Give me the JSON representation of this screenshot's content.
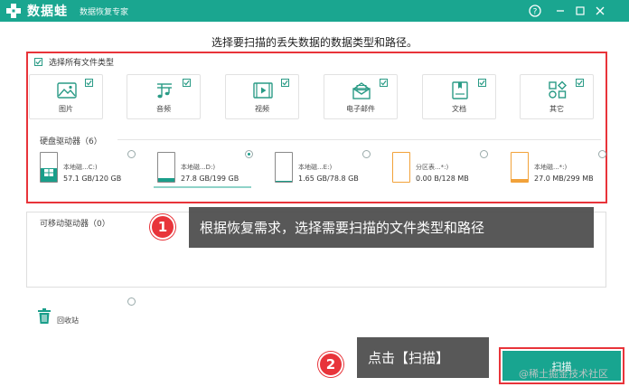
{
  "titlebar": {
    "brand": "数据蛙",
    "subtitle": "数据恢复专家",
    "help_icon": "question-circle-icon",
    "colors": {
      "bar": "#1aa690"
    }
  },
  "heading": "选择要扫描的丢失数据的数据类型和路径。",
  "select_all": {
    "label": "选择所有文件类型",
    "checked": true
  },
  "file_types": [
    {
      "label": "图片",
      "icon": "image-icon",
      "checked": true
    },
    {
      "label": "音频",
      "icon": "music-note-icon",
      "checked": true
    },
    {
      "label": "视频",
      "icon": "video-icon",
      "checked": true
    },
    {
      "label": "电子邮件",
      "icon": "email-icon",
      "checked": true
    },
    {
      "label": "文档",
      "icon": "document-icon",
      "checked": true
    },
    {
      "label": "其它",
      "icon": "other-shapes-icon",
      "checked": true
    }
  ],
  "hard_drives": {
    "label": "硬盘驱动器（6）",
    "items": [
      {
        "name": "本地磁...C:)",
        "size": "57.1 GB/120 GB",
        "fill": 0.48,
        "selected": false,
        "color": "#1a9e8a",
        "system": true
      },
      {
        "name": "本地磁...D:)",
        "size": "27.8 GB/199 GB",
        "fill": 0.14,
        "selected": true,
        "color": "#1a9e8a"
      },
      {
        "name": "本地磁...E:)",
        "size": "1.65 GB/78.8 GB",
        "fill": 0.02,
        "selected": false,
        "color": "#1a9e8a"
      },
      {
        "name": "分区表...*:)",
        "size": "0.00  B/128 MB",
        "fill": 0.0,
        "selected": false,
        "color": "#f2a23a"
      },
      {
        "name": "本地磁...*:)",
        "size": "27.0 MB/299 MB",
        "fill": 0.09,
        "selected": false,
        "color": "#f2a23a"
      }
    ]
  },
  "removable": {
    "label": "可移动驱动器（0）"
  },
  "recycle_bin": {
    "label": "回收站",
    "icon": "trash-icon"
  },
  "callouts": [
    {
      "number": "1",
      "text": "根据恢复需求，选择需要扫描的文件类型和路径"
    },
    {
      "number": "2",
      "text": "点击【扫描】"
    }
  ],
  "scan_button": {
    "label": "扫描"
  },
  "watermark": "@稀土掘金技术社区"
}
